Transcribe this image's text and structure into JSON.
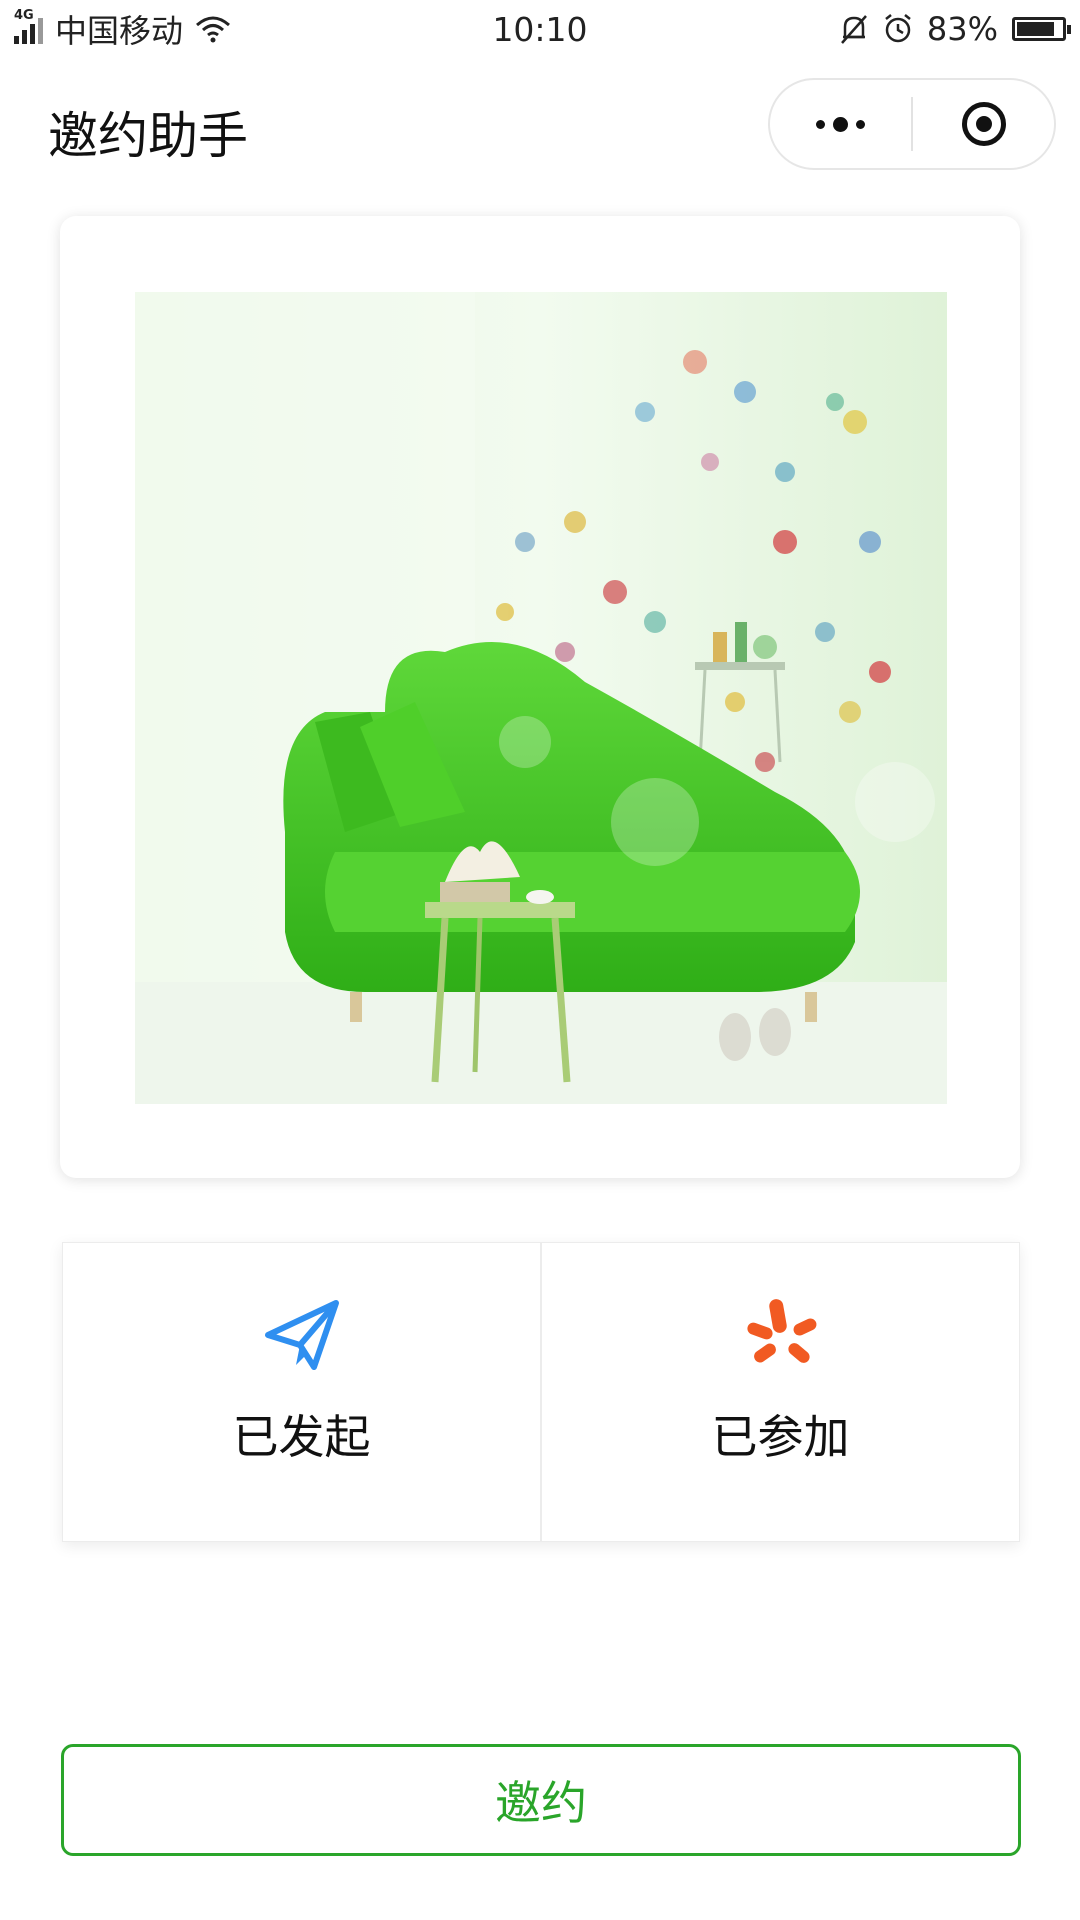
{
  "status_bar": {
    "network": "4G",
    "carrier": "中国移动",
    "time": "10:10",
    "battery_percent": "83%",
    "battery_level": 0.83,
    "icons": [
      "signal-icon",
      "wifi-icon",
      "mute-icon",
      "alarm-icon",
      "battery-icon"
    ]
  },
  "nav": {
    "title": "邀约助手",
    "more_icon": "more-dots-icon",
    "close_icon": "record-target-icon"
  },
  "banner": {
    "image": "green-sofa-room-photo"
  },
  "actions": [
    {
      "label": "已发起",
      "icon": "paper-plane-icon",
      "color": "#2f8ff0"
    },
    {
      "label": "已参加",
      "icon": "burst-icon",
      "color": "#f15a22"
    }
  ],
  "invite_button": {
    "label": "邀约",
    "color": "#2aa52a"
  }
}
